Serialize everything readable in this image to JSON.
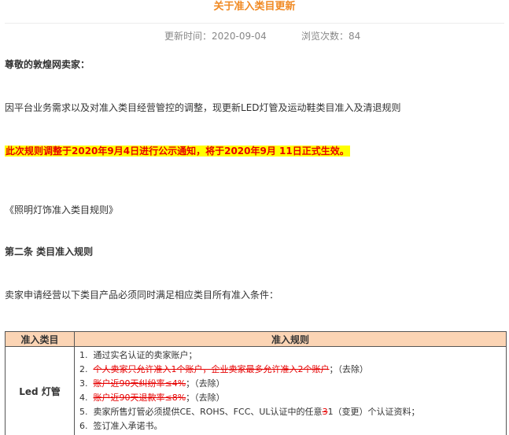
{
  "article": {
    "title": "关于准入类目更新",
    "updated_label": "更新时间：",
    "updated_value": "2020-09-04",
    "views_label": "浏览次数：",
    "views_value": "84",
    "greeting": "尊敬的敦煌网卖家：",
    "intro": "因平台业务需求以及对准入类目经营管控的调整，现更新LED灯管及运动鞋类目准入及清退规则",
    "notice": "此次规则调整于2020年9月4日进行公示通知，将于2020年9月 11日正式生效。",
    "rules_title": "《照明灯饰准入类目规则》",
    "article_heading": "第二条  类目准入规则",
    "requirement": "卖家申请经营以下类目产品必须同时满足相应类目所有准入条件："
  },
  "table": {
    "headers": [
      "准入类目",
      "准入规则"
    ],
    "category": "Led 灯管",
    "rules": [
      {
        "num": "1.",
        "struck": "",
        "text": "通过实名认证的卖家账户；",
        "struck2": "",
        "text2": ""
      },
      {
        "num": "2.",
        "struck": "个人卖家只允许准入1个账户，企业卖家最多允许准入2个账户",
        "text": "；（去除）",
        "struck2": "",
        "text2": ""
      },
      {
        "num": "3.",
        "struck": "账户近90天纠纷率≤4%",
        "text": "；（去除）",
        "struck2": "",
        "text2": ""
      },
      {
        "num": "4.",
        "struck": "账户近90天退款率≤8%",
        "text": "；（去除）",
        "struck2": "",
        "text2": ""
      },
      {
        "num": "5.",
        "struck": "",
        "text": "卖家所售灯管必须提供CE、ROHS、FCC、UL认证中的任意",
        "struck2": "3",
        "text2": "1（变更）个认证资料；"
      },
      {
        "num": "6.",
        "struck": "",
        "text": "签订准入承诺书。",
        "struck2": "",
        "text2": ""
      }
    ]
  }
}
